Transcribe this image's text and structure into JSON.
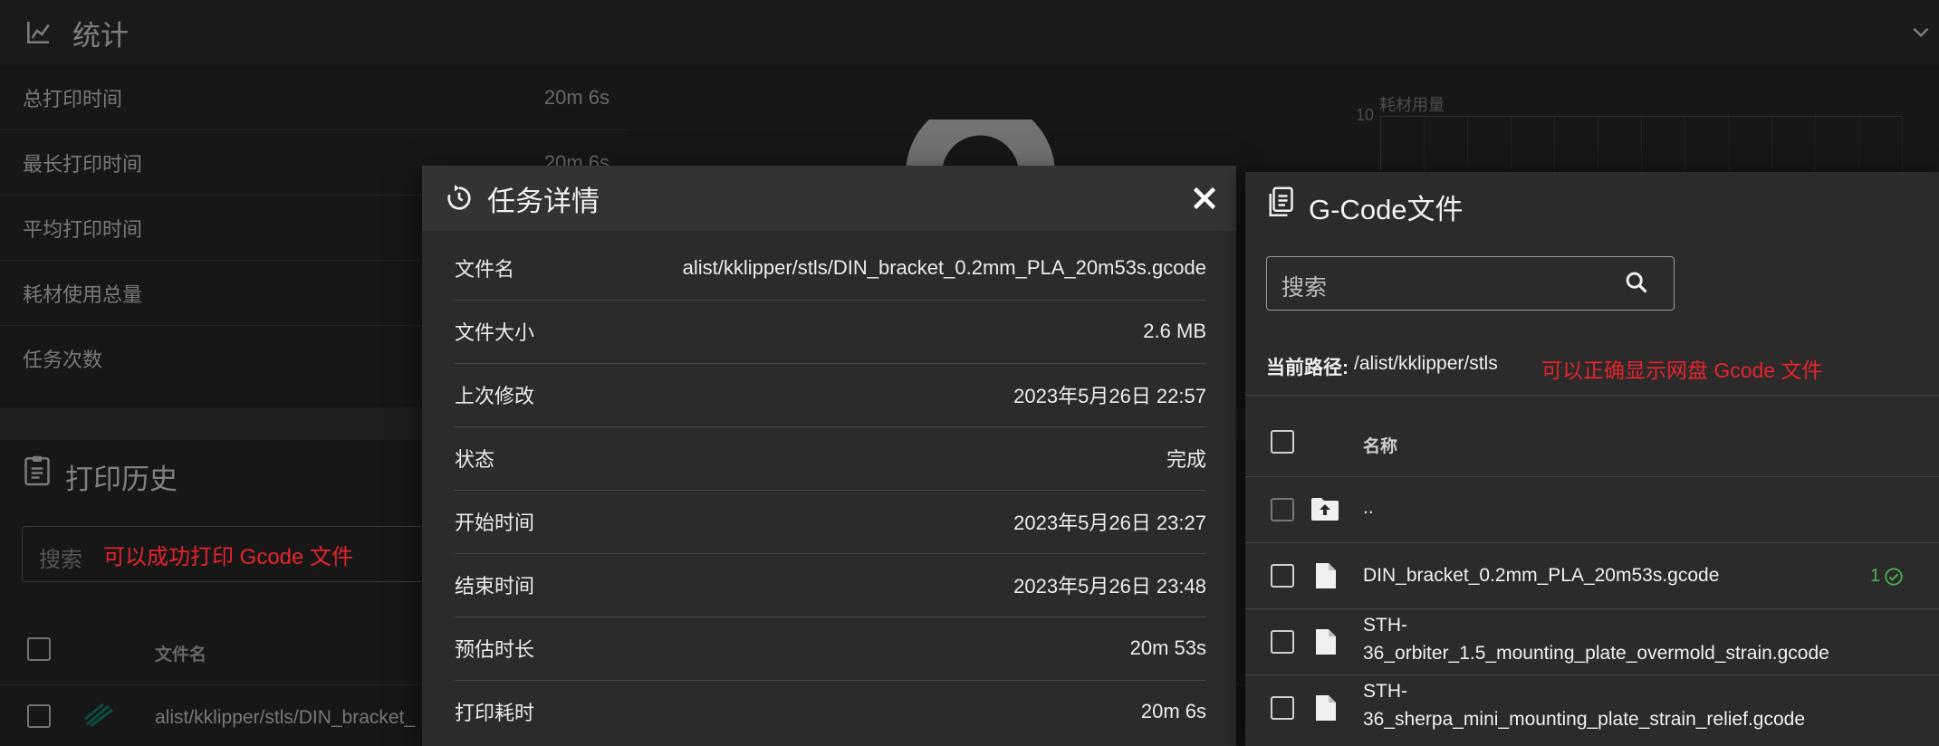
{
  "statistics": {
    "title": "统计",
    "rows": [
      {
        "label": "总打印时间",
        "value": "20m 6s"
      },
      {
        "label": "最长打印时间",
        "value": "20m 6s"
      },
      {
        "label": "平均打印时间",
        "value": ""
      },
      {
        "label": "耗材使用总量",
        "value": ""
      },
      {
        "label": "任务次数",
        "value": ""
      }
    ],
    "chart": {
      "title": "耗材用量",
      "y_tick": "10"
    }
  },
  "history": {
    "title": "打印历史",
    "search_placeholder": "搜索",
    "annotation": "可以成功打印 Gcode 文件",
    "column_filename": "文件名",
    "rows": [
      {
        "filename": "alist/kklipper/stls/DIN_bracket_"
      }
    ]
  },
  "dialog": {
    "title": "任务详情",
    "rows": [
      {
        "label": "文件名",
        "value": "alist/kklipper/stls/DIN_bracket_0.2mm_PLA_20m53s.gcode"
      },
      {
        "label": "文件大小",
        "value": "2.6 MB"
      },
      {
        "label": "上次修改",
        "value": "2023年5月26日 22:57"
      },
      {
        "label": "状态",
        "value": "完成"
      },
      {
        "label": "开始时间",
        "value": "2023年5月26日 23:27"
      },
      {
        "label": "结束时间",
        "value": "2023年5月26日 23:48"
      },
      {
        "label": "预估时长",
        "value": "20m 53s"
      },
      {
        "label": "打印耗时",
        "value": "20m 6s"
      }
    ]
  },
  "gcode_panel": {
    "title": "G-Code文件",
    "search_placeholder": "搜索",
    "path_label": "当前路径:",
    "path_value": "/alist/kklipper/stls",
    "annotation": "可以正确显示网盘 Gcode 文件",
    "column_name": "名称",
    "files": [
      {
        "name": "..",
        "kind": "folder-up"
      },
      {
        "name": "DIN_bracket_0.2mm_PLA_20m53s.gcode",
        "kind": "file",
        "print_count": "1"
      },
      {
        "name_line1": "STH-",
        "name_line2": "36_orbiter_1.5_mounting_plate_overmold_strain.gcode",
        "kind": "file"
      },
      {
        "name_line1": "STH-",
        "name_line2": "36_sherpa_mini_mounting_plate_strain_relief.gcode",
        "kind": "file"
      }
    ]
  },
  "colors": {
    "annotation_red": "#e5242b",
    "success_green": "#4caf50",
    "history_icon_teal": "#1a8a7a"
  }
}
